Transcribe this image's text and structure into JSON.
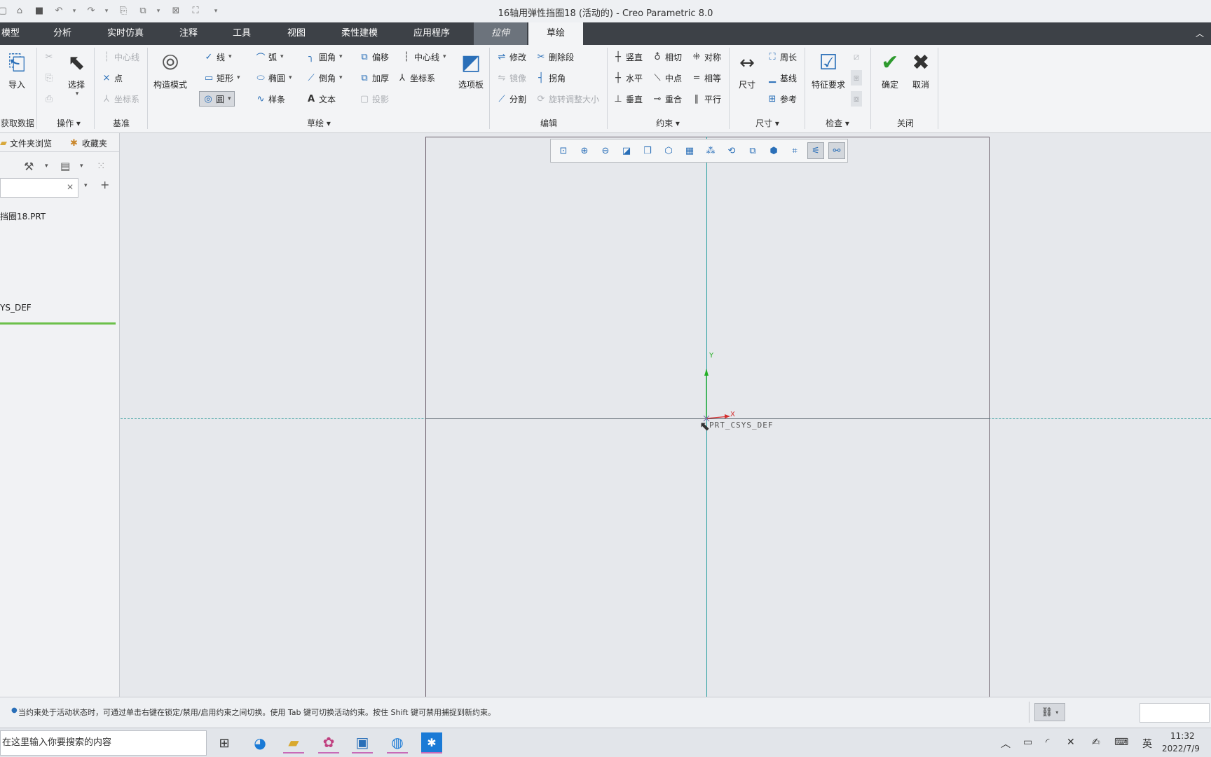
{
  "window": {
    "title": "16轴用弹性挡圈18 (活动的) - Creo Parametric 8.0"
  },
  "quick_access": [
    {
      "icon": "new-icon",
      "glyph": "▢"
    },
    {
      "icon": "open-icon",
      "glyph": "⌂"
    },
    {
      "icon": "save-icon",
      "glyph": "■"
    },
    {
      "icon": "undo-icon",
      "glyph": "↶"
    },
    {
      "icon": "undo-dropdown-icon",
      "glyph": "▾"
    },
    {
      "icon": "redo-icon",
      "glyph": "↷"
    },
    {
      "icon": "redo-dropdown-icon",
      "glyph": "▾"
    },
    {
      "icon": "regenerate-icon",
      "glyph": "⎘"
    },
    {
      "icon": "windows-icon",
      "glyph": "⧉"
    },
    {
      "icon": "windows-dropdown-icon",
      "glyph": "▾"
    },
    {
      "icon": "close-window-icon",
      "glyph": "⊠"
    },
    {
      "icon": "customize-icon",
      "glyph": "⛶"
    },
    {
      "icon": "more-icon",
      "glyph": "▾"
    }
  ],
  "tabs": [
    {
      "label": "模型",
      "state": "normal"
    },
    {
      "label": "分析",
      "state": "normal"
    },
    {
      "label": "实时仿真",
      "state": "normal"
    },
    {
      "label": "注释",
      "state": "normal"
    },
    {
      "label": "工具",
      "state": "normal"
    },
    {
      "label": "视图",
      "state": "normal"
    },
    {
      "label": "柔性建模",
      "state": "normal"
    },
    {
      "label": "应用程序",
      "state": "normal"
    },
    {
      "label": "拉伸",
      "state": "extension"
    },
    {
      "label": "草绘",
      "state": "active"
    }
  ],
  "ribbon": {
    "get_data": {
      "import": "导入",
      "group": "获取数据"
    },
    "operations": {
      "select": "选择",
      "group": "操作 ▾"
    },
    "datum": {
      "centerline": "中心线",
      "point": "点",
      "csys": "坐标系",
      "group": "基准"
    },
    "construction": {
      "label": "构造模式"
    },
    "sketch": {
      "line": "线",
      "arc": "弧",
      "fillet": "圆角",
      "offset": "偏移",
      "centerline": "中心线",
      "rectangle": "矩形",
      "ellipse": "椭圆",
      "chamfer": "倒角",
      "thicken": "加厚",
      "csys": "坐标系",
      "circle": "圆",
      "spline": "样条",
      "text": "文本",
      "project": "投影",
      "palette": "选项板",
      "group": "草绘 ▾"
    },
    "edit": {
      "modify": "修改",
      "delete_segment": "删除段",
      "mirror": "镜像",
      "corner": "拐角",
      "divide": "分割",
      "rotate_resize": "旋转调整大小",
      "group": "编辑"
    },
    "constrain": {
      "vertical": "竖直",
      "tangent": "相切",
      "symmetric": "对称",
      "horizontal": "水平",
      "midpoint": "中点",
      "equal": "相等",
      "perpendicular": "垂直",
      "coincident": "重合",
      "parallel": "平行",
      "group": "约束 ▾"
    },
    "dimension": {
      "dimension": "尺寸",
      "perimeter": "周长",
      "baseline": "基线",
      "reference": "参考",
      "group": "尺寸 ▾"
    },
    "inspect": {
      "feature_requirements": "特征要求",
      "group": "检查 ▾"
    },
    "close": {
      "ok": "确定",
      "cancel": "取消",
      "group": "关闭"
    }
  },
  "sidebar": {
    "tab_folder": "文件夹浏览",
    "tab_favorites": "收藏夹",
    "tree_item_1": "挡圈18.PRT",
    "tree_item_2": "YS_DEF",
    "clear": "✕",
    "add": "+"
  },
  "canvas": {
    "csys_label": "PRT_CSYS_DEF",
    "axis_x": "X",
    "axis_y": "Y"
  },
  "status": {
    "message": "当约束处于活动状态时，可通过单击右键在锁定/禁用/启用约束之间切换。使用 Tab 键可切换活动约束。按住 Shift 键可禁用捕捉到新约束。"
  },
  "taskbar": {
    "search_placeholder": "在这里输入你要搜索的内容",
    "ime": "英",
    "time": "11:32",
    "date": "2022/7/9"
  },
  "colors": {
    "ribbon_tab_bar": "#3d4147",
    "active_tab": "#f3f4f6",
    "accent": "#2a6fb8",
    "axis": "#2aa0a0",
    "ok_green": "#2e9a2e"
  }
}
